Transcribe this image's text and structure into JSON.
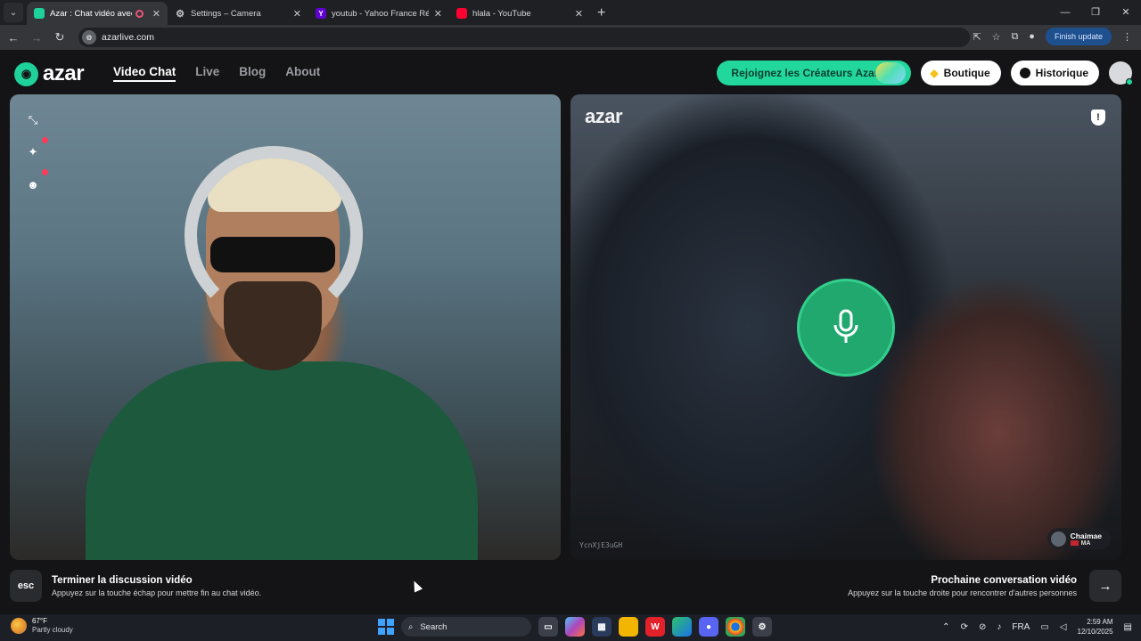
{
  "browser": {
    "tabs": [
      {
        "title": "Azar : Chat vidéo avec des n",
        "active": true,
        "favicon_color": "#1fd19a",
        "recording": true
      },
      {
        "title": "Settings – Camera",
        "active": false,
        "favicon": "gear-icon"
      },
      {
        "title": "youtub - Yahoo France Résultats",
        "active": false,
        "favicon": "Y",
        "favicon_color": "#6001d2"
      },
      {
        "title": "hlala - YouTube",
        "active": false,
        "favicon_color": "#ff0033"
      }
    ],
    "url": "azarlive.com",
    "update_label": "Finish update"
  },
  "app": {
    "logo_text": "azar",
    "nav": [
      {
        "label": "Video Chat",
        "active": true
      },
      {
        "label": "Live",
        "active": false
      },
      {
        "label": "Blog",
        "active": false
      },
      {
        "label": "About",
        "active": false
      }
    ],
    "cta_label": "Rejoignez les Créateurs Azar",
    "shop_label": "Boutique",
    "history_label": "Historique",
    "accent": "#21d79c"
  },
  "remote_panel": {
    "watermark": "azar",
    "peer_id": "YcnXjE3uGH",
    "peer_name": "Chaimae",
    "peer_country": "MA"
  },
  "hints": {
    "esc_key": "esc",
    "end_title": "Terminer la discussion vidéo",
    "end_sub": "Appuyez sur la touche échap pour mettre fin au chat vidéo.",
    "next_title": "Prochaine conversation vidéo",
    "next_sub": "Appuyez sur la touche droite pour rencontrer d'autres personnes"
  },
  "taskbar": {
    "temp": "67°F",
    "condition": "Partly cloudy",
    "search_placeholder": "Search",
    "lang": "FRA",
    "time": "2:59 AM",
    "date": "12/10/2025"
  }
}
